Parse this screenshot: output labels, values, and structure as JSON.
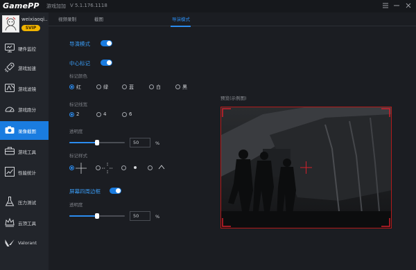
{
  "titlebar": {
    "logo": "GamePP",
    "app_name": "游戏加加",
    "version": "V 5.1.176.1118",
    "controls": [
      "menu-icon",
      "minimize-icon",
      "close-icon"
    ]
  },
  "profile": {
    "username": "weixiaoqi...",
    "badge": "SVIP"
  },
  "sidebar": {
    "items": [
      {
        "label": "硬件监控",
        "icon": "monitor-icon"
      },
      {
        "label": "游戏加速",
        "icon": "rocket-icon"
      },
      {
        "label": "游戏滤镜",
        "icon": "filter-icon"
      },
      {
        "label": "游戏跑分",
        "icon": "speedometer-icon"
      },
      {
        "label": "录像截图",
        "icon": "camera-icon",
        "active": true
      },
      {
        "label": "游戏工具",
        "icon": "toolbox-icon"
      },
      {
        "label": "性能统计",
        "icon": "chart-icon"
      },
      {
        "label": "压力测试",
        "icon": "flask-icon"
      },
      {
        "label": "云顶工具",
        "icon": "crown-icon"
      },
      {
        "label": "Valorant",
        "icon": "valorant-icon"
      }
    ]
  },
  "tabs": [
    {
      "label": "视频录制"
    },
    {
      "label": "截图"
    },
    {
      "label": "导演模式",
      "active": true
    }
  ],
  "settings": {
    "director_mode": {
      "label": "导演模式",
      "enabled": true
    },
    "center_mark": {
      "label": "中心标记",
      "enabled": true
    },
    "mark_color": {
      "label": "标记颜色",
      "options": [
        "红",
        "绿",
        "蓝",
        "白",
        "黑"
      ],
      "selected": "红"
    },
    "mark_width": {
      "label": "标记线宽",
      "options": [
        "2",
        "4",
        "6"
      ],
      "selected": "2"
    },
    "mark_opacity": {
      "label": "透明度",
      "value": "50",
      "unit": "%",
      "level": 0.5
    },
    "mark_style": {
      "label": "标记样式",
      "selected_index": 0
    },
    "screen_border": {
      "label": "屏幕四周边框",
      "enabled": true
    },
    "border_opacity": {
      "label": "透明度",
      "value": "50",
      "unit": "%",
      "level": 0.5
    }
  },
  "preview": {
    "label": "预览(示例图)"
  },
  "colors": {
    "accent": "#1a7ce0",
    "highlight": "#2b8cf0",
    "mark_red": "#d11f2a"
  }
}
